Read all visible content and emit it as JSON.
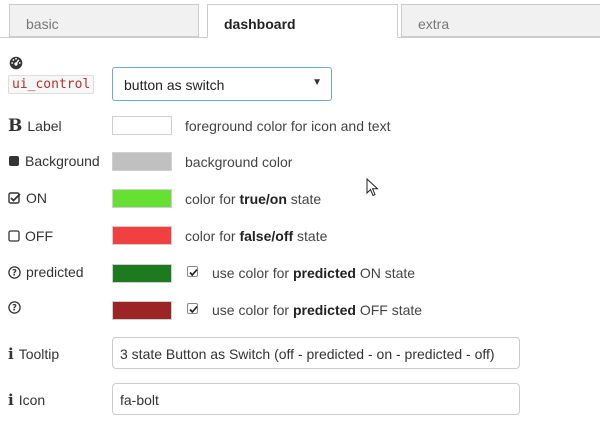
{
  "tabs": [
    {
      "label": "basic",
      "active": false
    },
    {
      "label": "dashboard",
      "active": true
    },
    {
      "label": "extra",
      "active": false
    }
  ],
  "control": {
    "icon": "dashboard-icon",
    "tag": "ui_control",
    "selected": "button as switch"
  },
  "rows": {
    "label": {
      "label": "Label",
      "icon": "bold-icon",
      "color": "#ffffff",
      "desc": "foreground color for icon and text"
    },
    "background": {
      "label": "Background",
      "icon": "filled-square-icon",
      "color": "#c0c0c0",
      "desc": "background color"
    },
    "on": {
      "label": "ON",
      "icon": "checkbox-checked-icon",
      "color": "#66e033",
      "desc_prefix": "color for ",
      "desc_bold": "true/on",
      "desc_suffix": " state"
    },
    "off": {
      "label": "OFF",
      "icon": "checkbox-empty-icon",
      "color": "#f04040",
      "desc_prefix": "color for ",
      "desc_bold": "false/off",
      "desc_suffix": " state"
    },
    "predicted_on": {
      "label": "predicted",
      "icon": "question-circle-icon",
      "color": "#1e7a1e",
      "checked": true,
      "desc_prefix": "use color for ",
      "desc_bold": "predicted",
      "desc_suffix": " ON state"
    },
    "predicted_off": {
      "label": "",
      "icon": "question-circle-icon",
      "color": "#9b2424",
      "checked": true,
      "desc_prefix": "use color for ",
      "desc_bold": "predicted",
      "desc_suffix": " OFF state"
    }
  },
  "tooltip": {
    "label": "Tooltip",
    "icon": "info-icon",
    "value": "3 state Button as Switch (off - predicted - on - predicted - off)"
  },
  "iconfield": {
    "label": "Icon",
    "icon": "info-icon",
    "value": "fa-bolt"
  }
}
